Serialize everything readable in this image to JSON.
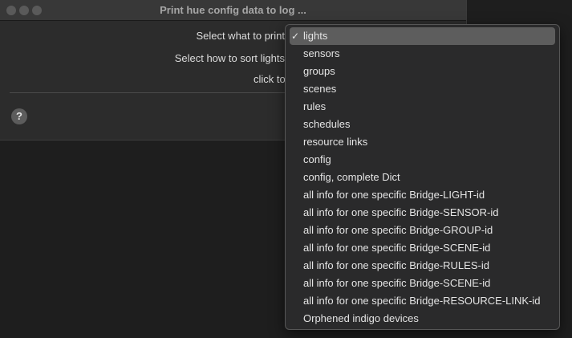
{
  "window": {
    "title": "Print hue config data to log ..."
  },
  "form": {
    "select_what_label": "Select what to print",
    "sort_lights_label": "Select how to sort lights",
    "click_to_label": "click to"
  },
  "help": {
    "symbol": "?"
  },
  "menu": {
    "checkmark": "✓",
    "items": [
      "lights",
      "sensors",
      "groups",
      "scenes",
      "rules",
      "schedules",
      "resource links",
      "config",
      "config, complete Dict",
      "all info for one specific Bridge-LIGHT-id",
      "all info for one specific Bridge-SENSOR-id",
      "all info for one specific Bridge-GROUP-id",
      "all info for one specific Bridge-SCENE-id",
      "all info for one specific Bridge-RULES-id",
      "all info for one specific Bridge-SCENE-id",
      "all info for one specific Bridge-RESOURCE-LINK-id",
      "Orphened indigo devices"
    ]
  },
  "colors": {
    "desktop_background": "#1e1e1e",
    "window_background": "#2c2c2c",
    "menu_background": "#2a2a2b",
    "menu_selection": "#5d5d5d"
  }
}
